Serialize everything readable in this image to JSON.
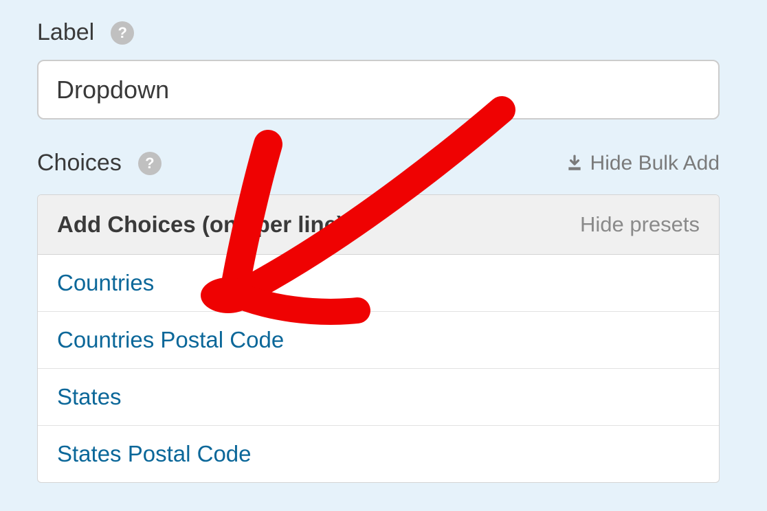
{
  "labelSection": {
    "title": "Label"
  },
  "labelInput": {
    "value": "Dropdown"
  },
  "choicesSection": {
    "title": "Choices"
  },
  "bulkToggle": {
    "label": "Hide Bulk Add"
  },
  "panel": {
    "title": "Add Choices (one per line)",
    "hidePresets": "Hide presets"
  },
  "presets": [
    "Countries",
    "Countries Postal Code",
    "States",
    "States Postal Code"
  ]
}
